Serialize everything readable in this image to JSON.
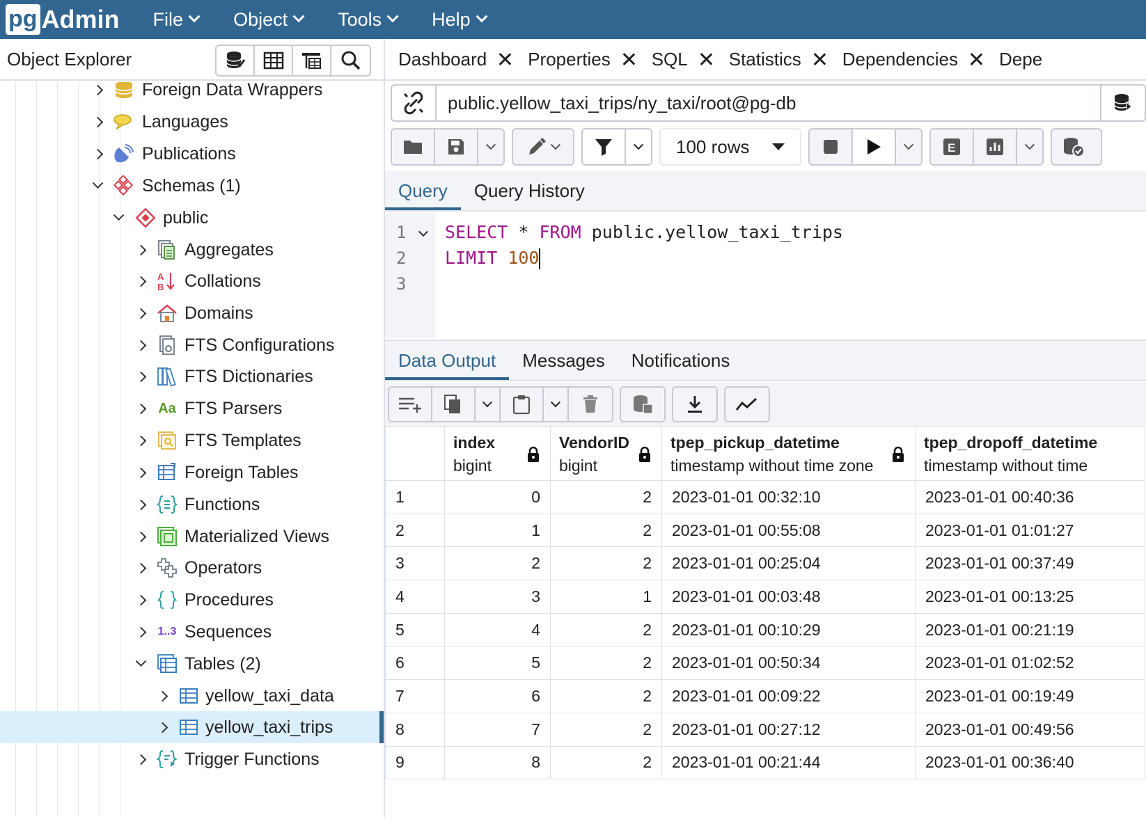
{
  "app": {
    "logo_pg": "pg",
    "logo_admin": "Admin",
    "menu": [
      "File",
      "Object",
      "Tools",
      "Help"
    ]
  },
  "object_explorer": {
    "title": "Object Explorer",
    "toolbar_icons": [
      "database-icon",
      "table-grid-icon",
      "query-tool-icon",
      "search-icon"
    ],
    "tree": [
      {
        "label": "Foreign Data Wrappers",
        "icon": "foreign-data-wrapper-icon",
        "expanded": false
      },
      {
        "label": "Languages",
        "icon": "language-icon",
        "expanded": false
      },
      {
        "label": "Publications",
        "icon": "publication-icon",
        "expanded": false
      },
      {
        "label": "Schemas (1)",
        "icon": "schemas-icon",
        "expanded": true
      },
      {
        "label": "public",
        "icon": "schema-icon",
        "expanded": true
      },
      {
        "label": "Aggregates",
        "icon": "aggregate-icon",
        "expanded": false
      },
      {
        "label": "Collations",
        "icon": "collation-icon",
        "expanded": false
      },
      {
        "label": "Domains",
        "icon": "domain-icon",
        "expanded": false
      },
      {
        "label": "FTS Configurations",
        "icon": "fts-configuration-icon",
        "expanded": false
      },
      {
        "label": "FTS Dictionaries",
        "icon": "fts-dictionary-icon",
        "expanded": false
      },
      {
        "label": "FTS Parsers",
        "icon": "fts-parser-icon",
        "expanded": false
      },
      {
        "label": "FTS Templates",
        "icon": "fts-template-icon",
        "expanded": false
      },
      {
        "label": "Foreign Tables",
        "icon": "foreign-table-icon",
        "expanded": false
      },
      {
        "label": "Functions",
        "icon": "function-icon",
        "expanded": false
      },
      {
        "label": "Materialized Views",
        "icon": "materialized-view-icon",
        "expanded": false
      },
      {
        "label": "Operators",
        "icon": "operator-icon",
        "expanded": false
      },
      {
        "label": "Procedures",
        "icon": "procedure-icon",
        "expanded": false
      },
      {
        "label": "Sequences",
        "icon": "sequence-icon",
        "expanded": false
      },
      {
        "label": "Tables (2)",
        "icon": "tables-icon",
        "expanded": true
      },
      {
        "label": "yellow_taxi_data",
        "icon": "table-icon",
        "expanded": false
      },
      {
        "label": "yellow_taxi_trips",
        "icon": "table-icon",
        "expanded": false,
        "selected": true
      },
      {
        "label": "Trigger Functions",
        "icon": "trigger-function-icon",
        "expanded": false
      }
    ]
  },
  "tabs": [
    "Dashboard",
    "Properties",
    "SQL",
    "Statistics",
    "Dependencies",
    "Depe"
  ],
  "connection": {
    "text": "public.yellow_taxi_trips/ny_taxi/root@pg-db"
  },
  "query_toolbar": {
    "rows_limit": "100 rows"
  },
  "query_tabs": [
    "Query",
    "Query History"
  ],
  "editor": {
    "line_numbers": [
      "1",
      "2",
      "3"
    ],
    "line1_kw1": "SELECT",
    "line1_mid": " * ",
    "line1_kw2": "FROM",
    "line1_rest": " public.yellow_taxi_trips",
    "line2_kw": "LIMIT",
    "line2_num": "100"
  },
  "output_tabs": [
    "Data Output",
    "Messages",
    "Notifications"
  ],
  "grid": {
    "columns": [
      {
        "name": "index",
        "type": "bigint"
      },
      {
        "name": "VendorID",
        "type": "bigint"
      },
      {
        "name": "tpep_pickup_datetime",
        "type": "timestamp without time zone"
      },
      {
        "name": "tpep_dropoff_datetime",
        "type": "timestamp without time"
      }
    ],
    "rows": [
      [
        "1",
        "0",
        "2",
        "2023-01-01 00:32:10",
        "2023-01-01 00:40:36"
      ],
      [
        "2",
        "1",
        "2",
        "2023-01-01 00:55:08",
        "2023-01-01 01:01:27"
      ],
      [
        "3",
        "2",
        "2",
        "2023-01-01 00:25:04",
        "2023-01-01 00:37:49"
      ],
      [
        "4",
        "3",
        "1",
        "2023-01-01 00:03:48",
        "2023-01-01 00:13:25"
      ],
      [
        "5",
        "4",
        "2",
        "2023-01-01 00:10:29",
        "2023-01-01 00:21:19"
      ],
      [
        "6",
        "5",
        "2",
        "2023-01-01 00:50:34",
        "2023-01-01 01:02:52"
      ],
      [
        "7",
        "6",
        "2",
        "2023-01-01 00:09:22",
        "2023-01-01 00:19:49"
      ],
      [
        "8",
        "7",
        "2",
        "2023-01-01 00:27:12",
        "2023-01-01 00:49:56"
      ],
      [
        "9",
        "8",
        "2",
        "2023-01-01 00:21:44",
        "2023-01-01 00:36:40"
      ]
    ]
  },
  "colors": {
    "brand": "#326690",
    "keyword": "#a1178a",
    "number": "#a0521e",
    "selected_row": "#dbeefc"
  }
}
